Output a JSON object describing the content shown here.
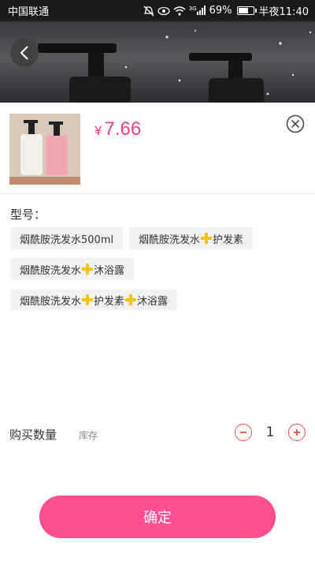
{
  "status_bar": {
    "carrier": "中国联通",
    "network": "3G",
    "battery": "69%",
    "battery_level": 0.69,
    "time": "半夜11:40"
  },
  "product": {
    "currency": "¥",
    "price": "7.66"
  },
  "spec": {
    "label": "型号：",
    "options": [
      {
        "label": "烟酰胺洗发水500ml"
      },
      {
        "parts": [
          "烟酰胺洗发水",
          "护发素"
        ]
      },
      {
        "parts": [
          "烟酰胺洗发水",
          "沐浴露"
        ]
      },
      {
        "parts": [
          "烟酰胺洗发水",
          "护发素",
          "沐浴露"
        ]
      }
    ]
  },
  "quantity": {
    "label": "购买数量",
    "stock_label": "库存",
    "value": "1"
  },
  "confirm": {
    "label": "确定"
  },
  "colors": {
    "price": "#ee3f8a",
    "confirm_bg": "#fb4f8f",
    "stepper": "#e5533d",
    "plus_icon": "#f2c315"
  },
  "icons": [
    "back-icon",
    "close-icon",
    "minus-icon",
    "plus-icon",
    "wifi-icon",
    "eye-icon",
    "mute-icon",
    "signal-icon",
    "battery-icon"
  ]
}
